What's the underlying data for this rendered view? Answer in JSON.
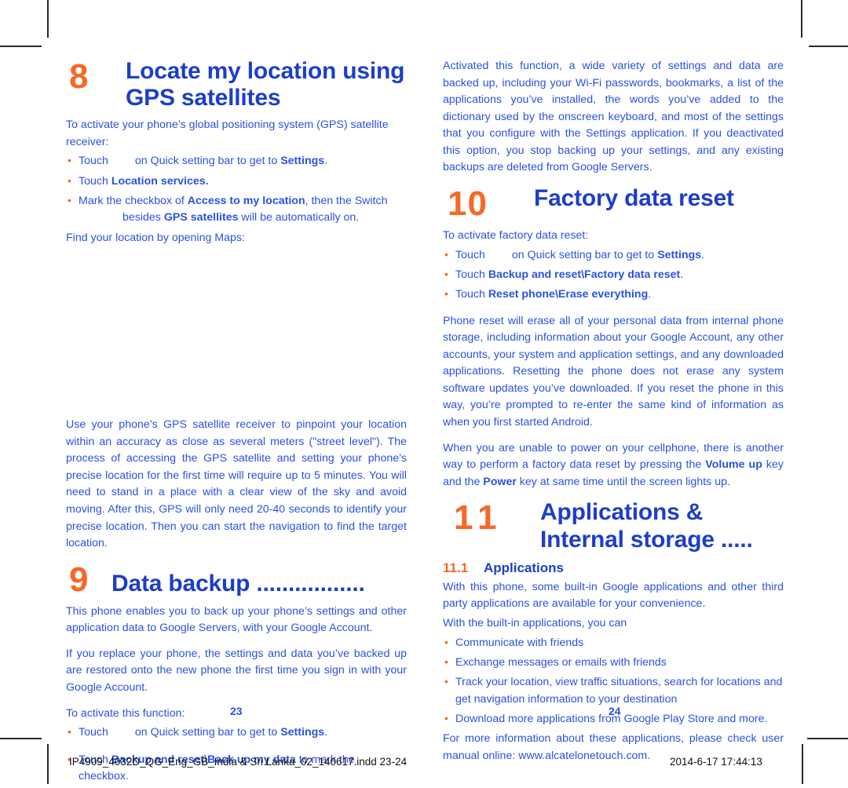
{
  "document": {
    "page_numbers": {
      "left": "23",
      "right": "24"
    },
    "footer": {
      "file": "IP4909_4032D_QG_Eng_GB_India & Sri Lanka_02_140617.indd   23-24",
      "timestamp": "2014-6-17   17:44:13"
    },
    "colors": {
      "orange": "#f96727",
      "heading_blue": "#1c3ec8",
      "body_blue": "#2a52de"
    }
  },
  "left_column": {
    "chapter8": {
      "number": "8",
      "title": "Locate my location using GPS satellites",
      "intro": "To activate your phone’s global positioning system (GPS) satellite receiver:",
      "bullets": [
        {
          "prefix": "Touch",
          "icon": "settings-icon",
          "rest_plain": "on Quick setting bar to get to ",
          "rest_bold": "Settings",
          "rest_tail": "."
        },
        {
          "plain_lead": "Touch ",
          "bold": "Location services.",
          "tail": ""
        },
        {
          "line1_lead": "Mark the checkbox of ",
          "line1_bold": "Access to my location",
          "line1_tail": ", then the Switch",
          "line2_lead": "besides ",
          "line2_bold": "GPS satellites",
          "line2_tail": " will be automatically on."
        }
      ],
      "maps_note": "Find your location by opening Maps:",
      "body": "Use your phone’s GPS satellite receiver to pinpoint your location within an accuracy as close as several meters (\"street level\"). The process of accessing the GPS satellite and setting your phone's precise location for the first time will require up to 5 minutes. You will need to stand in a place with a clear view of the sky and avoid moving. After this, GPS will only need 20-40 seconds to identify your precise location. Then you can start the navigation to find the target location."
    },
    "chapter9": {
      "number": "9",
      "title": "Data backup .................",
      "paragraph1": "This phone enables you to back up your phone’s settings and other application data to Google Servers, with your Google Account.",
      "paragraph2": "If you replace your phone, the settings and data you’ve backed up are restored onto the new phone the first time you sign in with your Google Account.",
      "activate_lead": "To activate this function:",
      "bullets": [
        {
          "prefix": "Touch",
          "icon": "settings-icon",
          "rest_plain": "on Quick setting bar to get to ",
          "rest_bold": "Settings",
          "rest_tail": "."
        },
        {
          "plain_lead": "Touch ",
          "bold": "Backup and reset\\Back up my data",
          "tail": " to mark the checkbox."
        }
      ]
    }
  },
  "right_column": {
    "backup_continued": "Activated this function, a wide variety of settings and data are backed up, including your Wi-Fi passwords, bookmarks, a list of the applications you’ve installed, the words you’ve added to the dictionary used by the onscreen keyboard, and most of the settings that you configure with the Settings application. If you deactivated this option, you stop backing up your settings, and any existing backups are deleted from Google Servers.",
    "chapter10": {
      "number": "10",
      "title": "Factory data reset",
      "intro": "To activate factory data reset:",
      "bullets": [
        {
          "prefix": "Touch",
          "icon": "settings-icon",
          "rest_plain": "on Quick setting bar to get to ",
          "rest_bold": "Settings",
          "rest_tail": "."
        },
        {
          "plain_lead": "Touch ",
          "bold": "Backup and reset\\Factory data reset",
          "tail": "."
        },
        {
          "plain_lead": "Touch ",
          "bold": "Reset phone\\Erase everything",
          "tail": "."
        }
      ],
      "paragraph1": "Phone reset will erase all of your personal data from internal phone storage, including information about your Google Account, any other accounts, your system and application settings, and any downloaded applications. Resetting the phone does not erase any system software updates you’ve downloaded. If you reset the phone in this way, you’re prompted to re-enter the same kind of information as when you first started Android.",
      "paragraph2_lead": "When you are unable to power on your cellphone, there is another way to perform a factory data reset by pressing the ",
      "paragraph2_bold1": "Volume up",
      "paragraph2_mid": " key and the ",
      "paragraph2_bold2": "Power",
      "paragraph2_tail": " key at same time until the screen lights up."
    },
    "chapter11": {
      "number": "11",
      "title": "Applications & Internal storage .....",
      "subsection": {
        "number": "11.1",
        "title": "Applications"
      },
      "paragraph1": "With this phone, some built-in Google applications and other third party applications are available for your convenience.",
      "paragraph2": "With the built-in applications, you can",
      "bullets": [
        "Communicate with friends",
        "Exchange messages or emails with friends",
        "Track your location, view traffic situations, search for locations and get navigation information to your destination",
        "Download more applications from Google Play Store and more."
      ],
      "closing": "For more information about these applications, please check user manual online: www.alcatelonetouch.com."
    }
  }
}
